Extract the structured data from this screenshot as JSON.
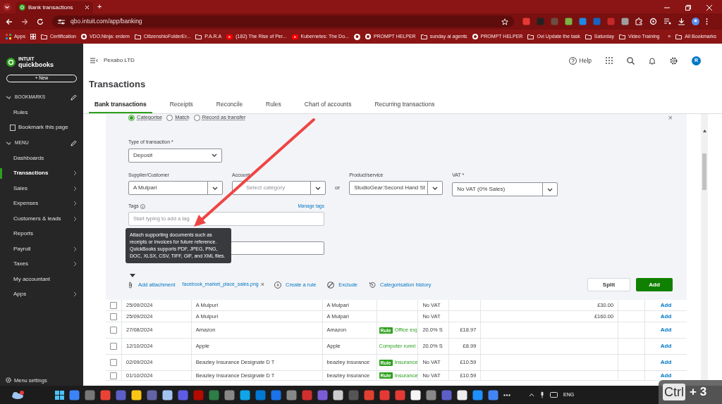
{
  "browser": {
    "tab_title": "Bank transactions",
    "new_tab": "+",
    "url": "qbo.intuit.com/app/banking",
    "bookmarks": [
      "Apps",
      "Certification",
      "VDO.Ninja: erdem",
      "CitizenshioFolderEr...",
      "P.A.R.A",
      "(182) The Rise of Per...",
      "Kubernetes: The Do...",
      "PROMPT HELPER",
      "sunday ai agents",
      "PROMPT HELPER",
      "Ovi Update the task",
      "Saturday",
      "Video Training"
    ],
    "more": "»",
    "all_bookmarks": "All Bookmarks"
  },
  "sidebar": {
    "logo_top": "INTUIT",
    "logo_bottom": "quickbooks",
    "new_button": "+ New",
    "sections": [
      {
        "title": "BOOKMARKS",
        "items": [
          {
            "label": "Rules",
            "icon": false,
            "expandable": false,
            "selected": false
          },
          {
            "label": "Bookmark this page",
            "icon": true,
            "expandable": false,
            "selected": false
          }
        ]
      },
      {
        "title": "MENU",
        "items": [
          {
            "label": "Dashboards",
            "icon": false,
            "expandable": false,
            "selected": false
          },
          {
            "label": "Transactions",
            "icon": false,
            "expandable": true,
            "selected": true
          },
          {
            "label": "Sales",
            "icon": false,
            "expandable": true,
            "selected": false
          },
          {
            "label": "Expenses",
            "icon": false,
            "expandable": true,
            "selected": false
          },
          {
            "label": "Customers & leads",
            "icon": false,
            "expandable": true,
            "selected": false
          },
          {
            "label": "Reports",
            "icon": false,
            "expandable": false,
            "selected": false
          },
          {
            "label": "Payroll",
            "icon": false,
            "expandable": true,
            "selected": false
          },
          {
            "label": "Taxes",
            "icon": false,
            "expandable": true,
            "selected": false
          },
          {
            "label": "My accountant",
            "icon": false,
            "expandable": false,
            "selected": false
          },
          {
            "label": "Apps",
            "icon": false,
            "expandable": true,
            "selected": false
          }
        ]
      }
    ],
    "settings": "Menu settings"
  },
  "header": {
    "company": "Pexabo LTD",
    "help": "Help",
    "avatar": "R"
  },
  "page_title": "Transactions",
  "tabs": [
    {
      "label": "Bank transactions",
      "selected": true
    },
    {
      "label": "Receipts",
      "selected": false
    },
    {
      "label": "Reconcile",
      "selected": false
    },
    {
      "label": "Rules",
      "selected": false
    },
    {
      "label": "Chart of accounts",
      "selected": false
    },
    {
      "label": "Recurring transactions",
      "selected": false
    }
  ],
  "form": {
    "close": "×",
    "modes": [
      {
        "label": "Categorise",
        "selected": true
      },
      {
        "label": "Match",
        "selected": false
      },
      {
        "label": "Record as transfer",
        "selected": false
      }
    ],
    "type": {
      "label": "Type of transaction *",
      "value": "Deposit"
    },
    "supplier": {
      "label": "Supplier/Customer",
      "value": "A Mulpari"
    },
    "account": {
      "label": "Account",
      "placeholder": "Select category"
    },
    "or": "or",
    "product": {
      "label": "Product/service",
      "value": "StudioGear:Second Hand St"
    },
    "vat": {
      "label": "VAT *",
      "value": "No VAT (0% Sales)"
    },
    "tags": {
      "label": "Tags",
      "manage": "Manage tags",
      "placeholder": "Start typing to add a tag"
    },
    "tooltip": "Attach supporting documents such as receipts or invoices for future reference. QuickBooks supports PDF, JPEG, PNG, DOC, XLSX, CSV, TIFF, GIF, and XML files.",
    "add_attachment": "Add attachment",
    "file": "facebook_market_place_sales.png",
    "remove_file": "×",
    "create_rule": "Create a rule",
    "exclude": "Exclude",
    "history": "Categorisation history",
    "split": "Split",
    "add": "Add"
  },
  "table": {
    "rows": [
      {
        "checked": false,
        "date": "25/09/2024",
        "description": "A Mulpuri",
        "payee": "A Mulpari",
        "category": "",
        "vat": "No VAT",
        "received": "£30.00",
        "action": "Add"
      },
      {
        "checked": false,
        "date": "25/09/2024",
        "description": "A Mulpuri",
        "payee": "A Mulpari",
        "category": "",
        "vat": "No VAT",
        "received": "£160.00",
        "action": "Add"
      },
      {
        "checked": false,
        "date": "27/08/2024",
        "description": "Amazon",
        "payee": "Amazon",
        "badge": "Rule",
        "category": "Office exp",
        "vat": "20.0% S",
        "spent": "£18.97",
        "action": "Add"
      },
      {
        "checked": false,
        "date": "12/10/2024",
        "description": "Apple",
        "payee": "Apple",
        "category": "Computer runni",
        "vat": "20.0% S",
        "spent": "£8.99",
        "action": "Add"
      },
      {
        "checked": false,
        "date": "02/09/2024",
        "description": "Beazley Insurance Designate D T",
        "payee": "beazley insurance",
        "badge": "Rule",
        "category": "Insurance",
        "vat": "No VAT",
        "spent": "£10.59",
        "action": "Add"
      },
      {
        "checked": false,
        "date": "01/10/2024",
        "description": "Beazley Insurance Designate D T",
        "payee": "beazley insurance",
        "badge": "Rule",
        "category": "Insurance",
        "vat": "No VAT",
        "spent": "£10.59",
        "action": "Add"
      }
    ]
  },
  "taskbar": {
    "language": "ENG"
  },
  "key_overlay": {
    "keys": "Ctrl",
    "plus": "+ 3"
  }
}
